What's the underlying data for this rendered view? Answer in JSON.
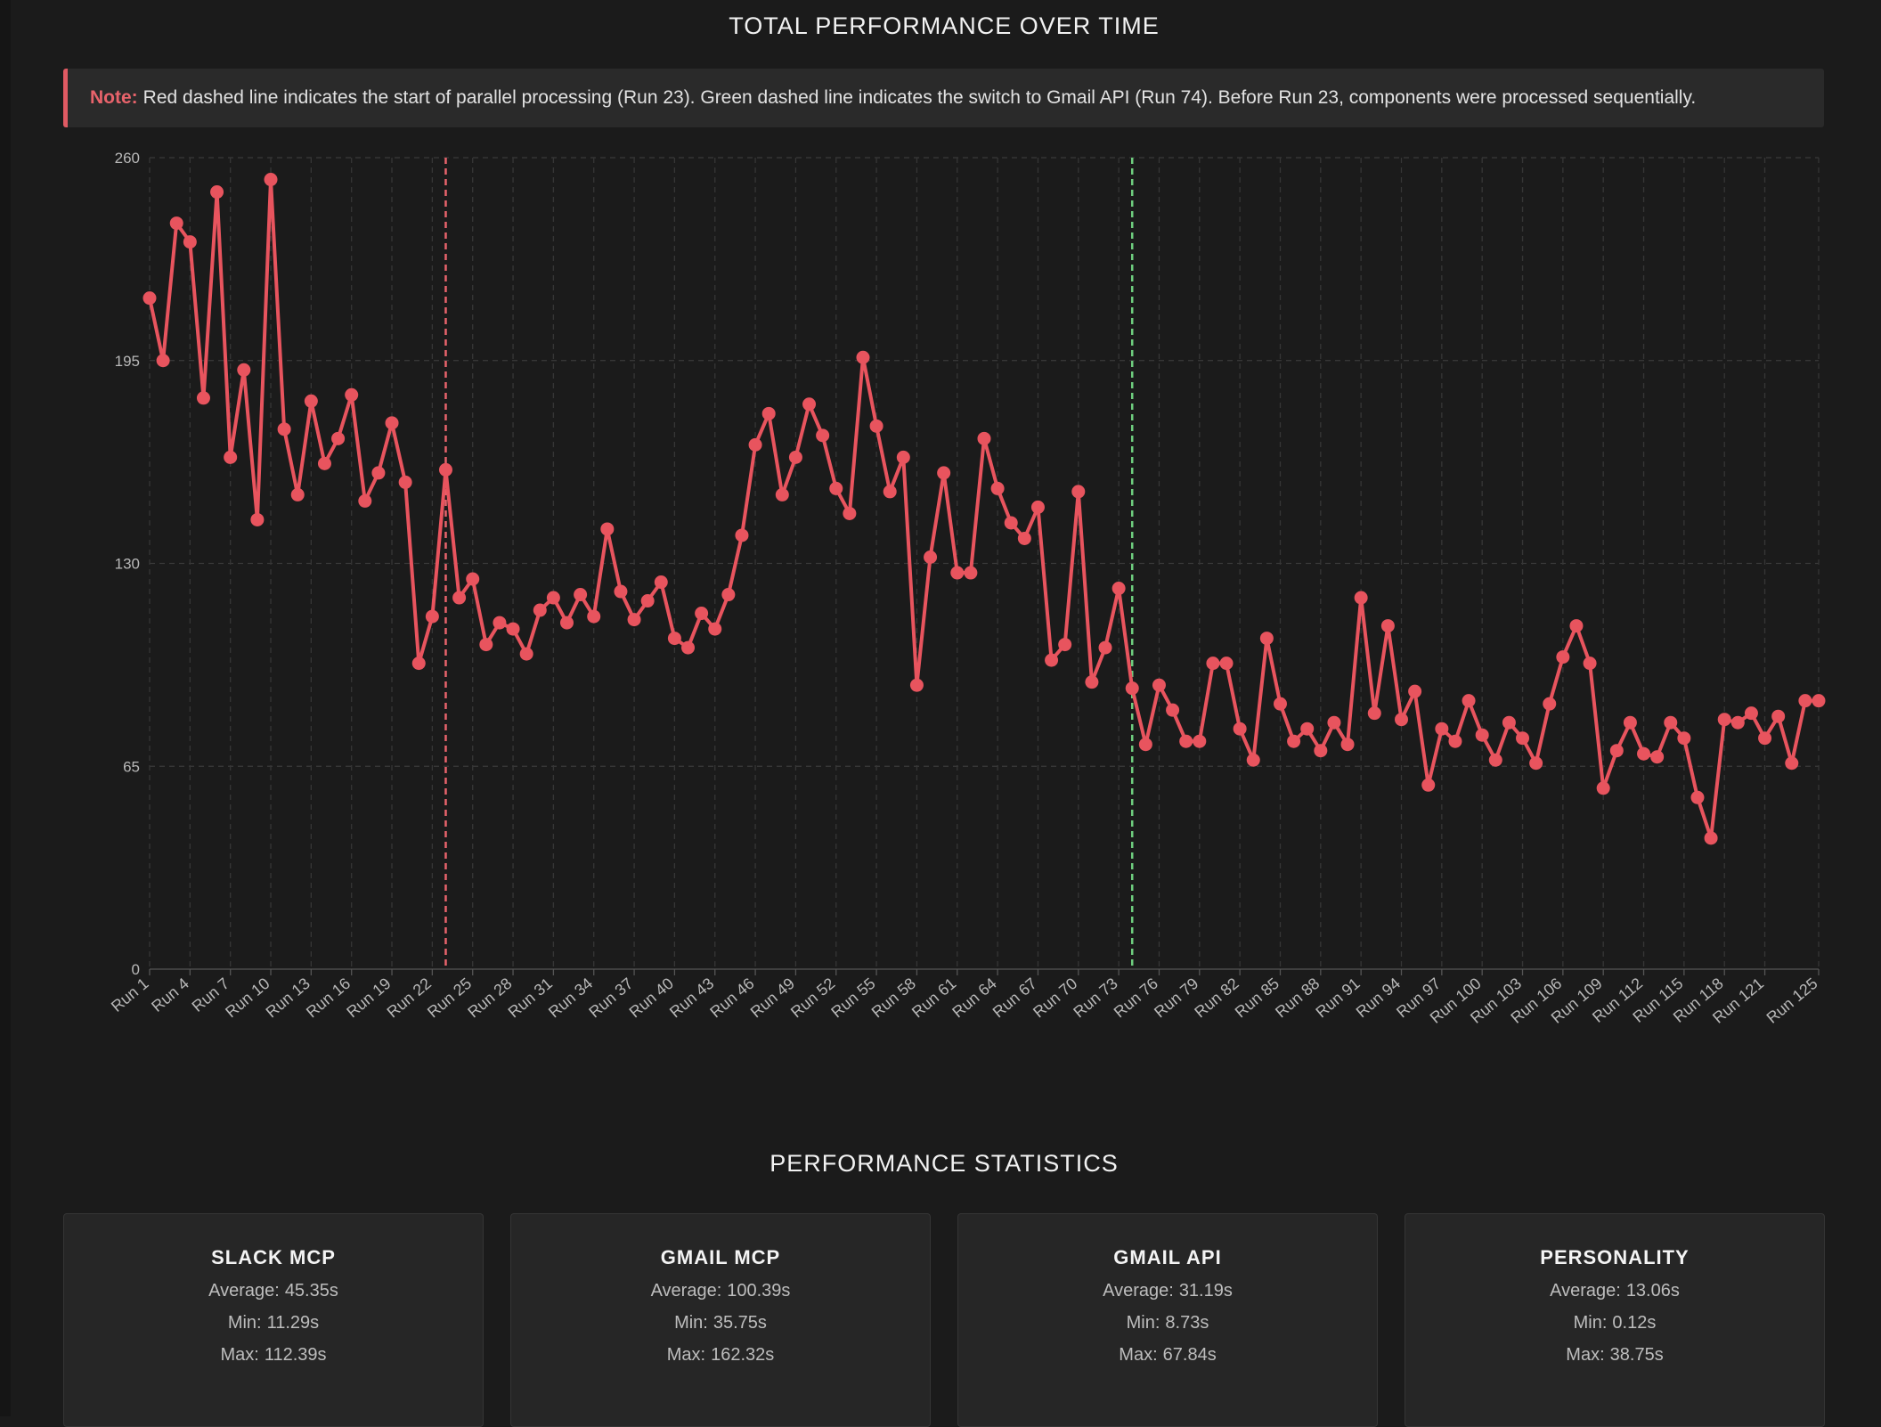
{
  "chart_title": "TOTAL PERFORMANCE OVER TIME",
  "note": {
    "label": "Note:",
    "text": "Red dashed line indicates the start of parallel processing (Run 23). Green dashed line indicates the switch to Gmail API (Run 74). Before Run 23, components were processed sequentially."
  },
  "colors": {
    "line": "#e8545e",
    "parallel_marker": "#e8636b",
    "api_marker": "#6fcf7f",
    "background": "#1b1b1b",
    "note_border": "#e05a63"
  },
  "chart_data": {
    "type": "line",
    "title": "",
    "xlabel": "",
    "ylabel": "",
    "ylim": [
      0,
      260
    ],
    "y_ticks": [
      0,
      65,
      130,
      195,
      260
    ],
    "x_tick_labels": [
      "Run 1",
      "Run 4",
      "Run 7",
      "Run 10",
      "Run 13",
      "Run 16",
      "Run 19",
      "Run 22",
      "Run 25",
      "Run 28",
      "Run 31",
      "Run 34",
      "Run 37",
      "Run 40",
      "Run 43",
      "Run 46",
      "Run 49",
      "Run 52",
      "Run 55",
      "Run 58",
      "Run 61",
      "Run 64",
      "Run 67",
      "Run 70",
      "Run 73",
      "Run 76",
      "Run 79",
      "Run 82",
      "Run 85",
      "Run 88",
      "Run 91",
      "Run 94",
      "Run 97",
      "Run 100",
      "Run 103",
      "Run 106",
      "Run 109",
      "Run 112",
      "Run 115",
      "Run 118",
      "Run 121",
      "Run 125"
    ],
    "grid": true,
    "vertical_markers": [
      {
        "run": 23,
        "color": "#e8636b"
      },
      {
        "run": 74,
        "color": "#6fcf7f"
      }
    ],
    "series": [
      {
        "name": "",
        "x_start": 1,
        "values": [
          215,
          195,
          239,
          233,
          183,
          249,
          164,
          192,
          144,
          253,
          173,
          152,
          182,
          162,
          170,
          184,
          150,
          159,
          175,
          156,
          98,
          113,
          160,
          119,
          125,
          104,
          111,
          109,
          101,
          115,
          119,
          111,
          120,
          113,
          141,
          121,
          112,
          118,
          124,
          106,
          103,
          114,
          109,
          120,
          139,
          168,
          178,
          152,
          164,
          181,
          171,
          154,
          146,
          196,
          174,
          153,
          164,
          91,
          132,
          159,
          127,
          127,
          170,
          154,
          143,
          138,
          148,
          99,
          104,
          153,
          92,
          103,
          122,
          90,
          72,
          91,
          83,
          73,
          73,
          98,
          98,
          77,
          67,
          106,
          85,
          73,
          77,
          70,
          79,
          72,
          119,
          82,
          110,
          80,
          89,
          59,
          77,
          73,
          86,
          75,
          67,
          79,
          74,
          66,
          85,
          100,
          110,
          98,
          58,
          70,
          79,
          69,
          68,
          79,
          74,
          55,
          42,
          80,
          79,
          82,
          74,
          81,
          66,
          86,
          86
        ]
      }
    ]
  },
  "stats_title": "PERFORMANCE STATISTICS",
  "stats": [
    {
      "name": "SLACK MCP",
      "average_label": "Average:",
      "average": "45.35s",
      "min_label": "Min:",
      "min": "11.29s",
      "max_label": "Max:",
      "max": "112.39s"
    },
    {
      "name": "GMAIL MCP",
      "average_label": "Average:",
      "average": "100.39s",
      "min_label": "Min:",
      "min": "35.75s",
      "max_label": "Max:",
      "max": "162.32s"
    },
    {
      "name": "GMAIL API",
      "average_label": "Average:",
      "average": "31.19s",
      "min_label": "Min:",
      "min": "8.73s",
      "max_label": "Max:",
      "max": "67.84s"
    },
    {
      "name": "PERSONALITY",
      "average_label": "Average:",
      "average": "13.06s",
      "min_label": "Min:",
      "min": "0.12s",
      "max_label": "Max:",
      "max": "38.75s"
    }
  ]
}
